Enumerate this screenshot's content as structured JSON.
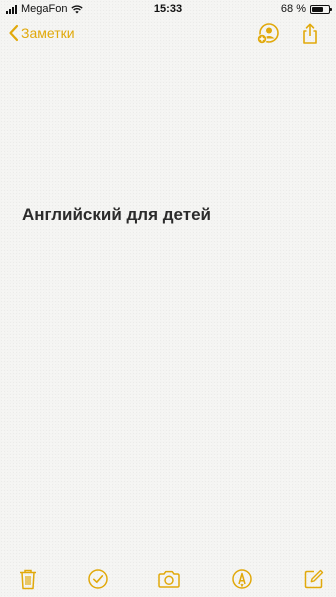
{
  "status_bar": {
    "carrier": "MegaFon",
    "time": "15:33",
    "battery_percent_label": "68 %",
    "battery_level": 0.68
  },
  "nav": {
    "back_label": "Заметки",
    "icons": [
      "chevron-left-icon",
      "add-person-icon",
      "share-icon"
    ]
  },
  "note": {
    "title": "Английский для детей"
  },
  "toolbar": {
    "icons": [
      "trash-icon",
      "checklist-icon",
      "camera-icon",
      "markup-icon",
      "compose-icon"
    ]
  },
  "colors": {
    "accent": "#e1a90b",
    "background": "#f4f4f2",
    "text": "#2b2b2b"
  }
}
